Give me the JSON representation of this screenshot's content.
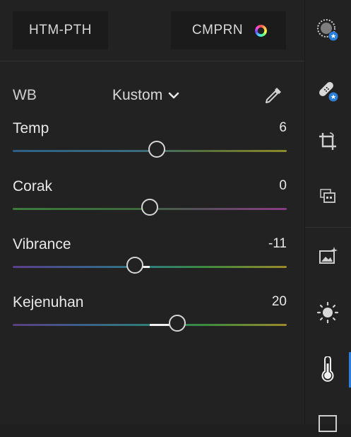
{
  "top": {
    "htm_pth_label": "HTM-PTH",
    "compare_label": "CMPRN"
  },
  "wb": {
    "label": "WB",
    "value": "Kustom"
  },
  "sliders": [
    {
      "name": "Temp",
      "value": "6",
      "position": 0.525
    },
    {
      "name": "Corak",
      "value": "0",
      "position": 0.5
    },
    {
      "name": "Vibrance",
      "value": "-11",
      "position": 0.445
    },
    {
      "name": "Kejenuhan",
      "value": "20",
      "position": 0.6
    }
  ],
  "rail": {
    "icons": [
      "selective-mask-icon",
      "healing-bandage-icon",
      "crop-icon",
      "presets-icon",
      "image-sparkle-icon",
      "light-sun-icon",
      "thermometer-icon",
      "frame-icon"
    ],
    "active": "thermometer-icon",
    "accent": "#2d7ed9"
  }
}
